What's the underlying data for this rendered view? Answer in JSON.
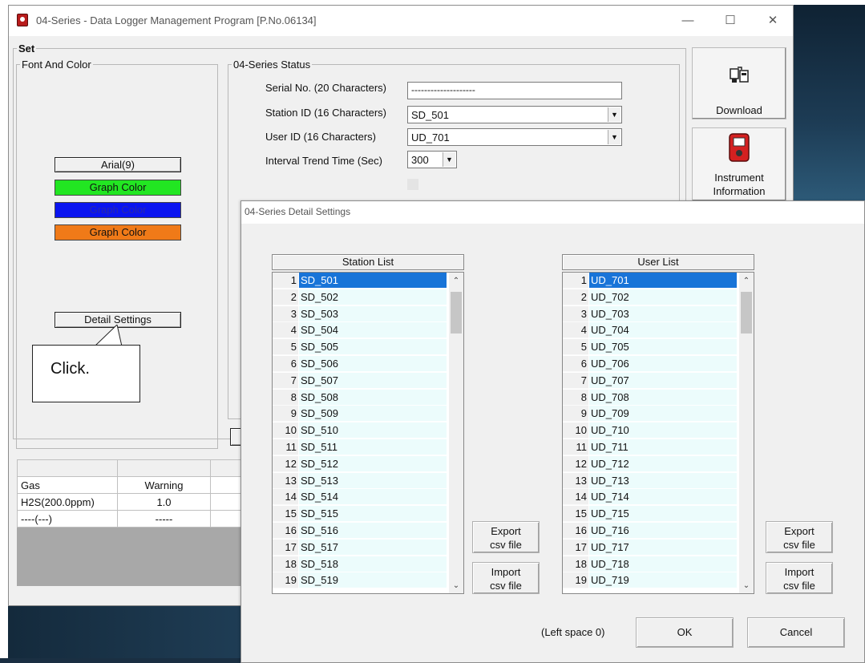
{
  "window": {
    "title": "04-Series - Data Logger Management Program [P.No.06134]",
    "minimize": "—",
    "maximize": "☐",
    "close": "✕"
  },
  "set_panel": {
    "legend": "Set",
    "font_color": {
      "legend": "Font And Color",
      "font_button": "Arial(9)",
      "graph_colors": [
        {
          "label": "Graph Color",
          "bg": "#22e622",
          "fg": "#111111"
        },
        {
          "label": "Graph Color",
          "bg": "#0a14f0",
          "fg": "#2a2aa8"
        },
        {
          "label": "Graph Color",
          "bg": "#f07a18",
          "fg": "#111111"
        }
      ],
      "detail_button": "Detail Settings"
    },
    "callout": "Click."
  },
  "status_panel": {
    "legend": "04-Series Status",
    "serial_label": "Serial No. (20 Characters)",
    "serial_value": "--------------------",
    "station_label": "Station ID (16 Characters)",
    "station_value": "SD_501",
    "user_label": "User ID (16 Characters)",
    "user_value": "UD_701",
    "interval_label": "Interval Trend Time (Sec)",
    "interval_value": "300"
  },
  "right_buttons": {
    "download": "Download",
    "instrument_line1": "Instrument",
    "instrument_line2": "Information"
  },
  "gas_table": {
    "headers": [
      "Gas",
      "Warning"
    ],
    "rows": [
      [
        "H2S(200.0ppm)",
        "1.0"
      ],
      [
        "----(---)",
        "-----"
      ]
    ]
  },
  "dialog": {
    "title": "04-Series Detail Settings",
    "station_list": {
      "header": "Station List",
      "items": [
        "SD_501",
        "SD_502",
        "SD_503",
        "SD_504",
        "SD_505",
        "SD_506",
        "SD_507",
        "SD_508",
        "SD_509",
        "SD_510",
        "SD_511",
        "SD_512",
        "SD_513",
        "SD_514",
        "SD_515",
        "SD_516",
        "SD_517",
        "SD_518",
        "SD_519"
      ]
    },
    "user_list": {
      "header": "User List",
      "items": [
        "UD_701",
        "UD_702",
        "UD_703",
        "UD_704",
        "UD_705",
        "UD_706",
        "UD_707",
        "UD_708",
        "UD_709",
        "UD_710",
        "UD_711",
        "UD_712",
        "UD_713",
        "UD_714",
        "UD_715",
        "UD_716",
        "UD_717",
        "UD_718",
        "UD_719"
      ]
    },
    "export_line1": "Export",
    "export_line2": "csv file",
    "import_line1": "Import",
    "import_line2": "csv file",
    "left_space": "(Left space 0)",
    "ok": "OK",
    "cancel": "Cancel",
    "selected_index": 0
  }
}
